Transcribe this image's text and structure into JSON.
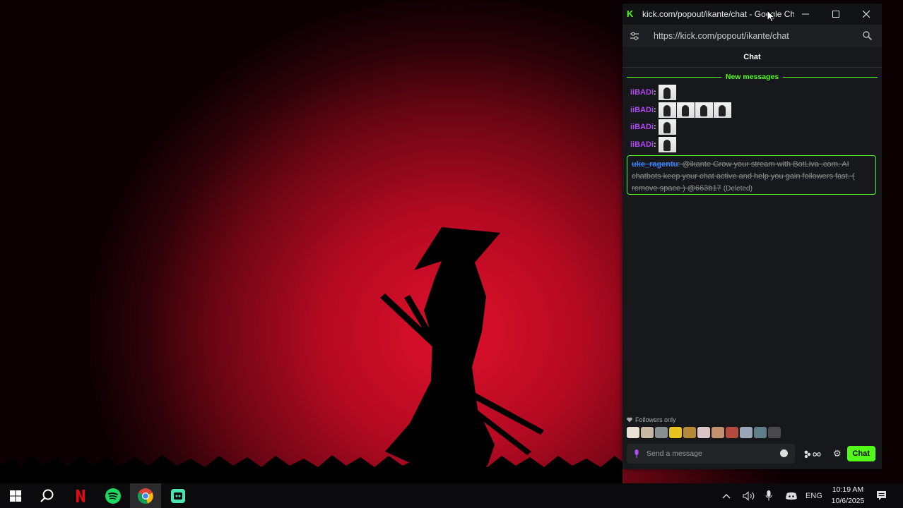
{
  "browser": {
    "title": "kick.com/popout/ikante/chat - Google Ch...",
    "url": "https://kick.com/popout/ikante/chat",
    "logo_letter": "K"
  },
  "chat": {
    "header": "Chat",
    "new_messages_label": "New messages",
    "messages": [
      {
        "user": "iiBADi",
        "emote_count": 1
      },
      {
        "user": "iiBADi",
        "emote_count": 4
      },
      {
        "user": "iiBADi",
        "emote_count": 1
      },
      {
        "user": "iiBADi",
        "emote_count": 1
      }
    ],
    "deleted_message": {
      "user": "uke_ragentu",
      "text": "@ikante Grow your stream with BotLiva .com. AI chatbots keep your chat active and help you gain followers fast. ( remove space ) @663b17",
      "tag": "(Deleted)"
    },
    "followers_only": "Followers only",
    "input_placeholder": "Send a message",
    "send_label": "Chat"
  },
  "taskbar": {
    "language": "ENG",
    "time": "10:19 AM",
    "date": "10/6/2025"
  },
  "colors": {
    "kick_green": "#53fc18",
    "username_purple": "#b24bf3",
    "username_blue": "#3b82f6"
  }
}
